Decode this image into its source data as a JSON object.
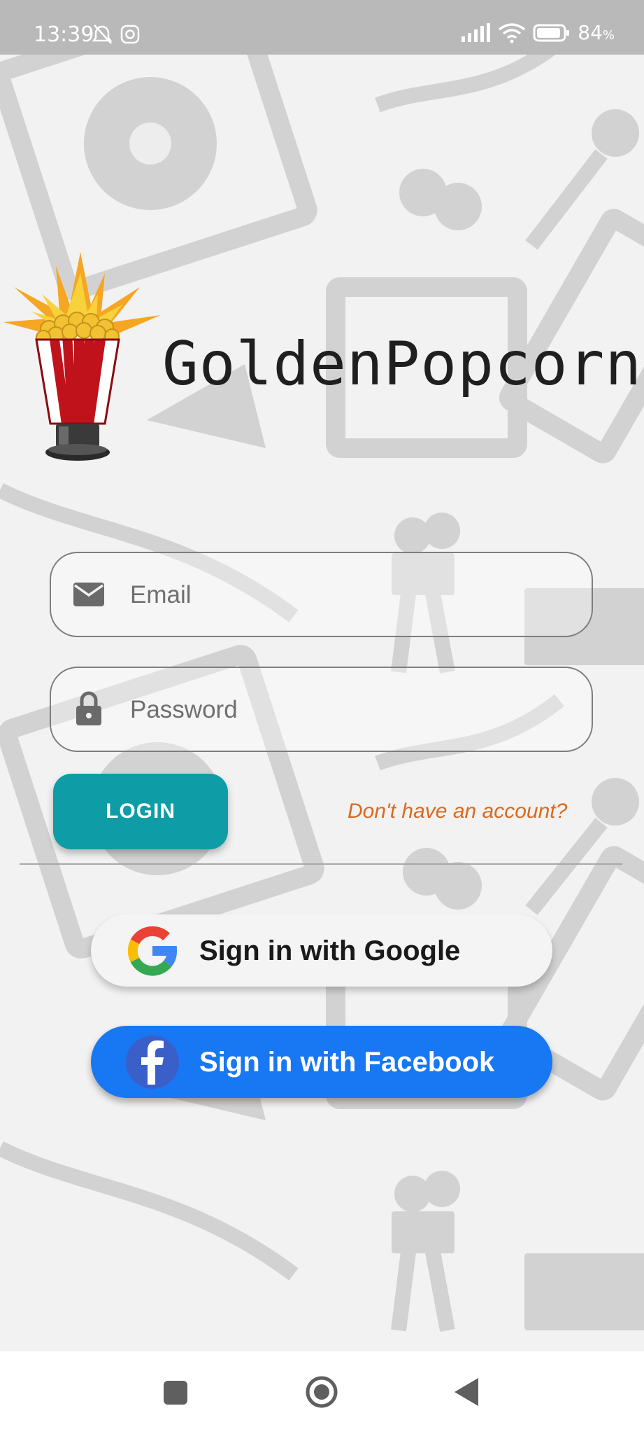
{
  "status_bar": {
    "time": "13:39",
    "battery_percent": "84",
    "battery_suffix": "%",
    "icons": [
      "mute-bell-icon",
      "instagram-icon",
      "signal-icon",
      "wifi-icon",
      "battery-icon"
    ]
  },
  "app": {
    "name": "GoldenPopcorn",
    "logo_icon": "popcorn-trophy-icon"
  },
  "form": {
    "email_placeholder": "Email",
    "password_placeholder": "Password",
    "login_label": "LOGIN",
    "signup_link": "Don't have an account?"
  },
  "social": {
    "google_label": "Sign in with Google",
    "facebook_label": "Sign in with Facebook"
  },
  "nav": {
    "icons": [
      "recents-square-icon",
      "home-circle-icon",
      "back-triangle-icon"
    ]
  },
  "colors": {
    "accent": "#0e9da6",
    "link": "#d96a1e",
    "facebook": "#1877f2",
    "status_bar": "#b9b9b9"
  }
}
